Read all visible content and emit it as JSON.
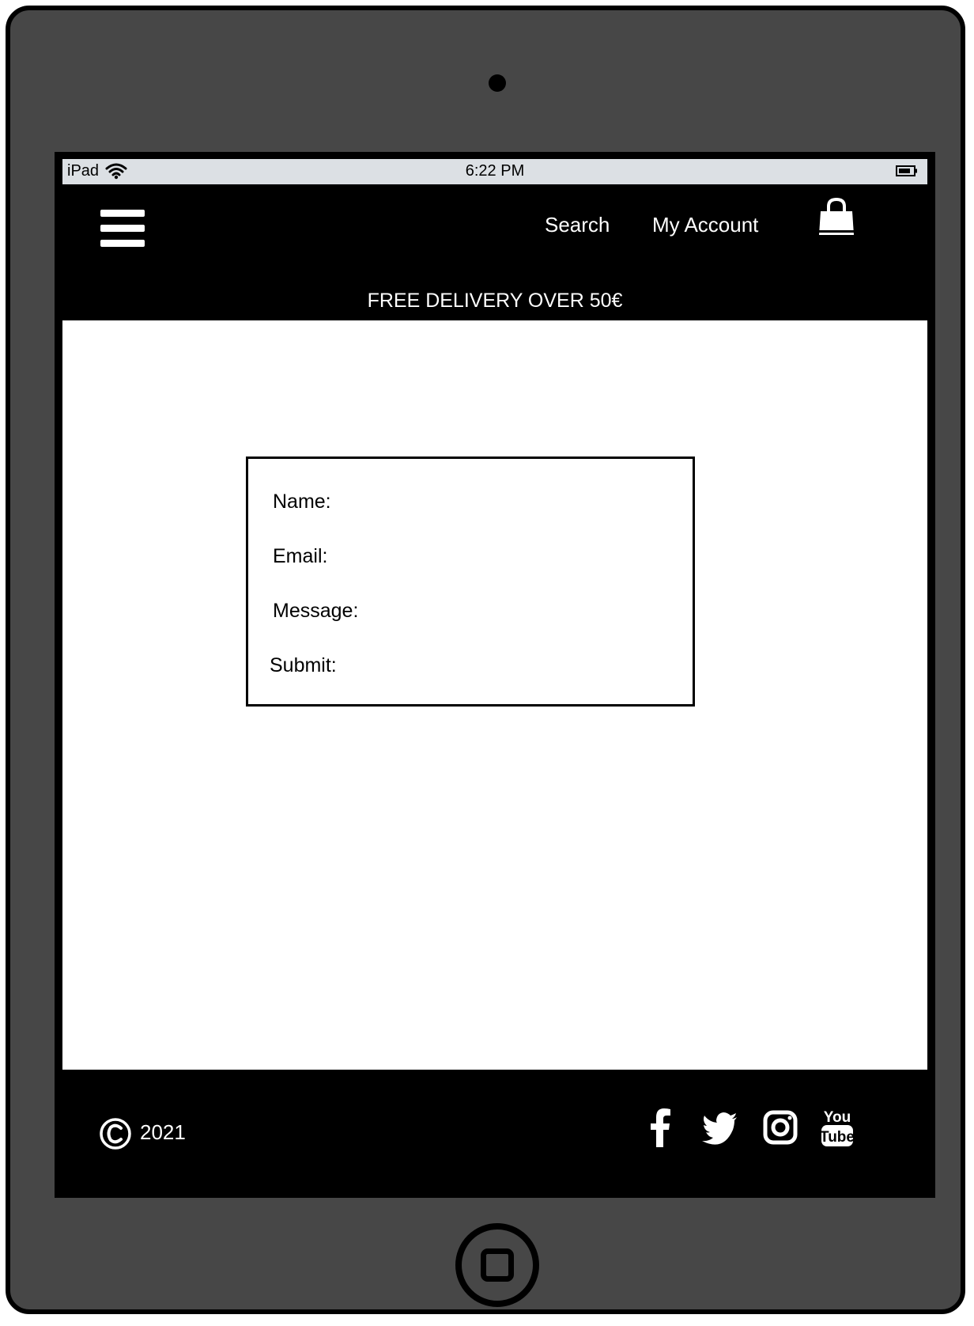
{
  "status_bar": {
    "device": "iPad",
    "time": "6:22 PM"
  },
  "header": {
    "nav": {
      "search": "Search",
      "account": "My Account"
    },
    "promo": "FREE DELIVERY OVER 50€"
  },
  "form": {
    "name_label": "Name:",
    "email_label": "Email:",
    "message_label": "Message:",
    "submit_label": "Submit:"
  },
  "footer": {
    "copyright_year": "2021",
    "social": [
      "facebook-icon",
      "twitter-icon",
      "instagram-icon",
      "youtube-icon"
    ],
    "youtube_word_1": "You",
    "youtube_word_2": "Tube"
  },
  "colors": {
    "device_body": "#474747",
    "bar": "#000000",
    "status_bar": "#dce0e4",
    "content": "#ffffff",
    "text_light": "#ffffff"
  }
}
